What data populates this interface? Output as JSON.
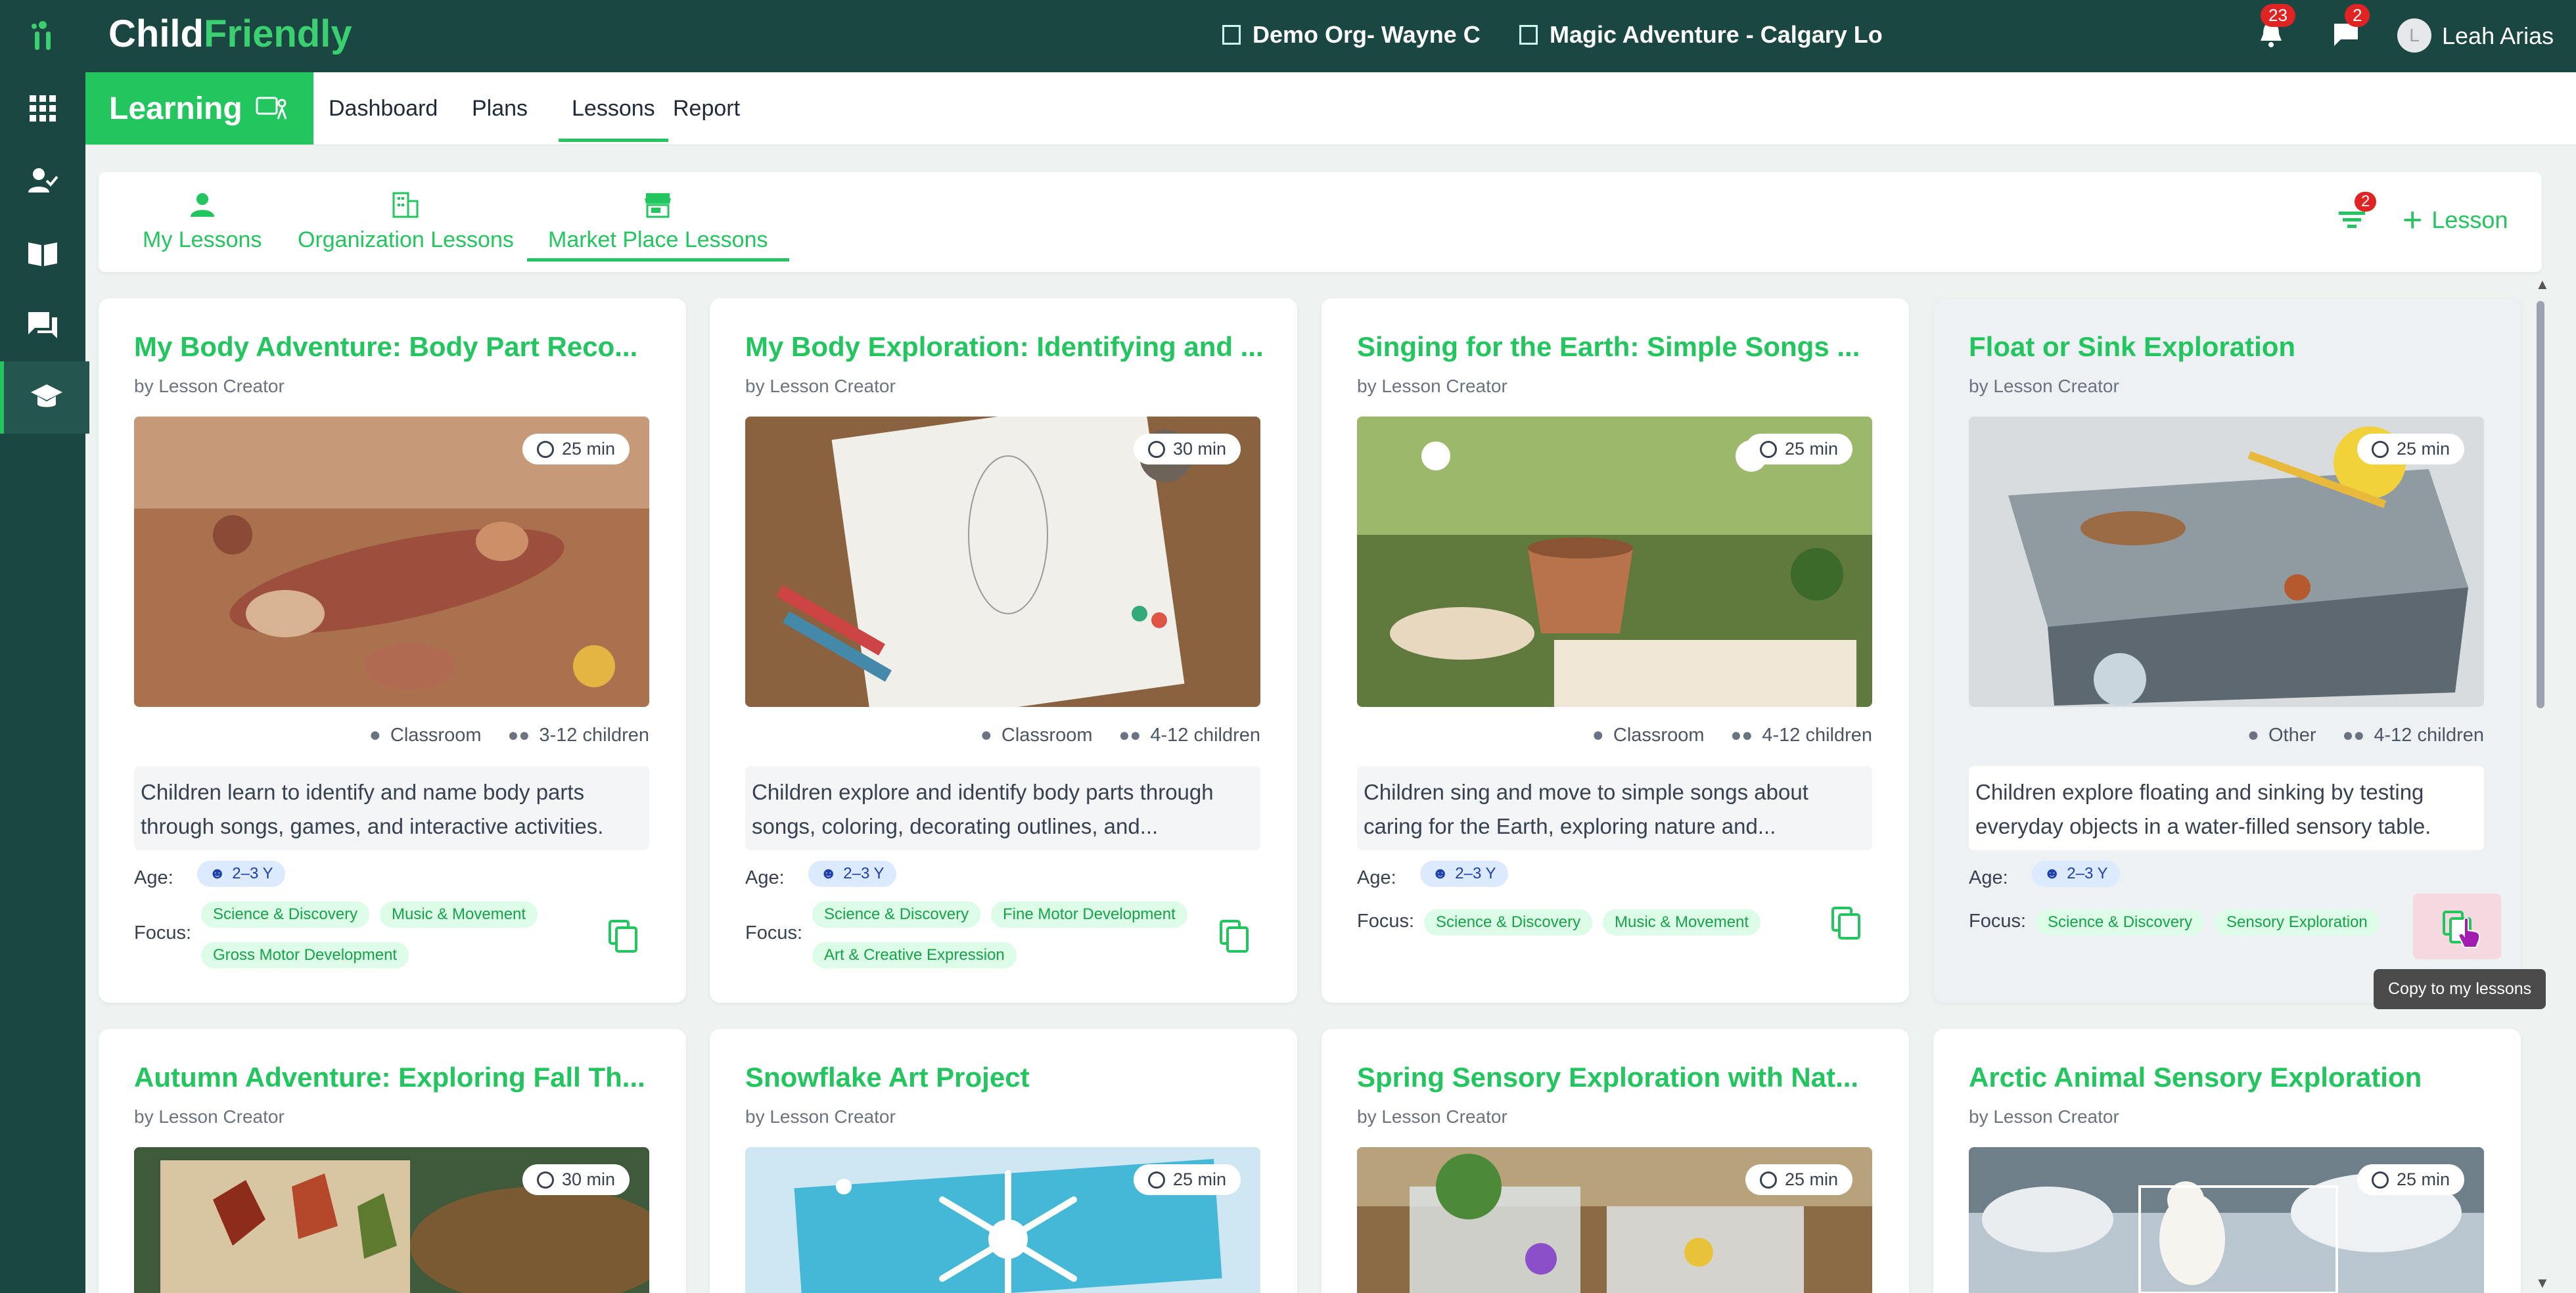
{
  "app": {
    "logo_main": "Child",
    "logo_accent": "Friendly"
  },
  "header": {
    "org": "Demo Org- Wayne C",
    "location": "Magic Adventure - Calgary Lo",
    "notifications_count": "23",
    "messages_count": "2",
    "user_initial": "L",
    "user_name": "Leah Arias"
  },
  "subnav": {
    "section": "Learning",
    "links": [
      "Dashboard",
      "Plans",
      "Lessons",
      "Report"
    ],
    "active": "Lessons"
  },
  "tabs": {
    "items": [
      "My Lessons",
      "Organization Lessons",
      "Market Place Lessons"
    ],
    "active": "Market Place Lessons",
    "filter_count": "2",
    "add_lesson": "Lesson"
  },
  "cards": [
    {
      "title": "My Body Adventure: Body Part Reco...",
      "author": "by Lesson Creator",
      "duration": "25 min",
      "location": "Classroom",
      "children": "3-12 children",
      "description": "Children learn to identify and name body parts through songs, games, and interactive activities.",
      "age_label": "Age:",
      "age": "2–3 Y",
      "focus_label": "Focus:",
      "focus": [
        "Science & Discovery",
        "Music & Movement",
        "Gross Motor Development"
      ]
    },
    {
      "title": "My Body Exploration: Identifying and ...",
      "author": "by Lesson Creator",
      "duration": "30 min",
      "location": "Classroom",
      "children": "4-12 children",
      "description": "Children explore and identify body parts through songs, coloring, decorating outlines, and...",
      "age_label": "Age:",
      "age": "2–3 Y",
      "focus_label": "Focus:",
      "focus": [
        "Science & Discovery",
        "Fine Motor Development",
        "Art & Creative Expression"
      ]
    },
    {
      "title": "Singing for the Earth: Simple Songs ...",
      "author": "by Lesson Creator",
      "duration": "25 min",
      "location": "Classroom",
      "children": "4-12 children",
      "description": "Children sing and move to simple songs about caring for the Earth, exploring nature and...",
      "age_label": "Age:",
      "age": "2–3 Y",
      "focus_label": "Focus:",
      "focus": [
        "Science & Discovery",
        "Music & Movement"
      ]
    },
    {
      "title": "Float or Sink Exploration",
      "author": "by Lesson Creator",
      "duration": "25 min",
      "location": "Other",
      "children": "4-12 children",
      "description": "Children explore floating and sinking by testing everyday objects in a water-filled sensory table.",
      "age_label": "Age:",
      "age": "2–3 Y",
      "focus_label": "Focus:",
      "focus": [
        "Science & Discovery",
        "Sensory Exploration"
      ]
    },
    {
      "title": "Autumn Adventure: Exploring Fall Th...",
      "author": "by Lesson Creator",
      "duration": "30 min"
    },
    {
      "title": "Snowflake Art Project",
      "author": "by Lesson Creator",
      "duration": "25 min"
    },
    {
      "title": "Spring Sensory Exploration with Nat...",
      "author": "by Lesson Creator",
      "duration": "25 min"
    },
    {
      "title": "Arctic Animal Sensory Exploration",
      "author": "by Lesson Creator",
      "duration": "25 min"
    }
  ],
  "tooltip": "Copy to my lessons",
  "colors": {
    "primary": "#22c55e",
    "sidebar": "#1b4742",
    "badge": "#e02424"
  }
}
